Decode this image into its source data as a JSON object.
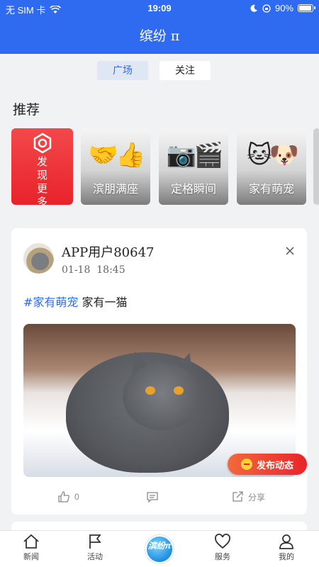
{
  "status_bar": {
    "carrier": "无 SIM 卡",
    "time": "19:09",
    "battery": "90%",
    "battery_level": 0.9
  },
  "header": {
    "title": "缤纷 π"
  },
  "tabs": [
    {
      "label": "广场",
      "active": true
    },
    {
      "label": "关注",
      "active": false
    }
  ],
  "recommend": {
    "title": "推荐",
    "discover_label": "发现更多",
    "cards": [
      {
        "label": "滨朋满座",
        "emoji": "🤝👍"
      },
      {
        "label": "定格瞬间",
        "emoji": "📷🎬"
      },
      {
        "label": "家有萌宠",
        "emoji": "🐱🐶"
      }
    ]
  },
  "post": {
    "username": "APP用户80647",
    "date": "01-18",
    "time": "18:45",
    "hashtag": "#家有萌宠",
    "text": "家有一猫",
    "likes": "0",
    "share_label": "分享"
  },
  "fab": {
    "label": "发布动态"
  },
  "navbar": {
    "items": [
      {
        "label": "新闻"
      },
      {
        "label": "活动"
      },
      {
        "label": "服务"
      },
      {
        "label": "我的"
      }
    ],
    "center_label": "滨纷π"
  },
  "colors": {
    "primary": "#2f6bf0",
    "accent_red": "#e8232a",
    "background": "#f1f2f4"
  }
}
